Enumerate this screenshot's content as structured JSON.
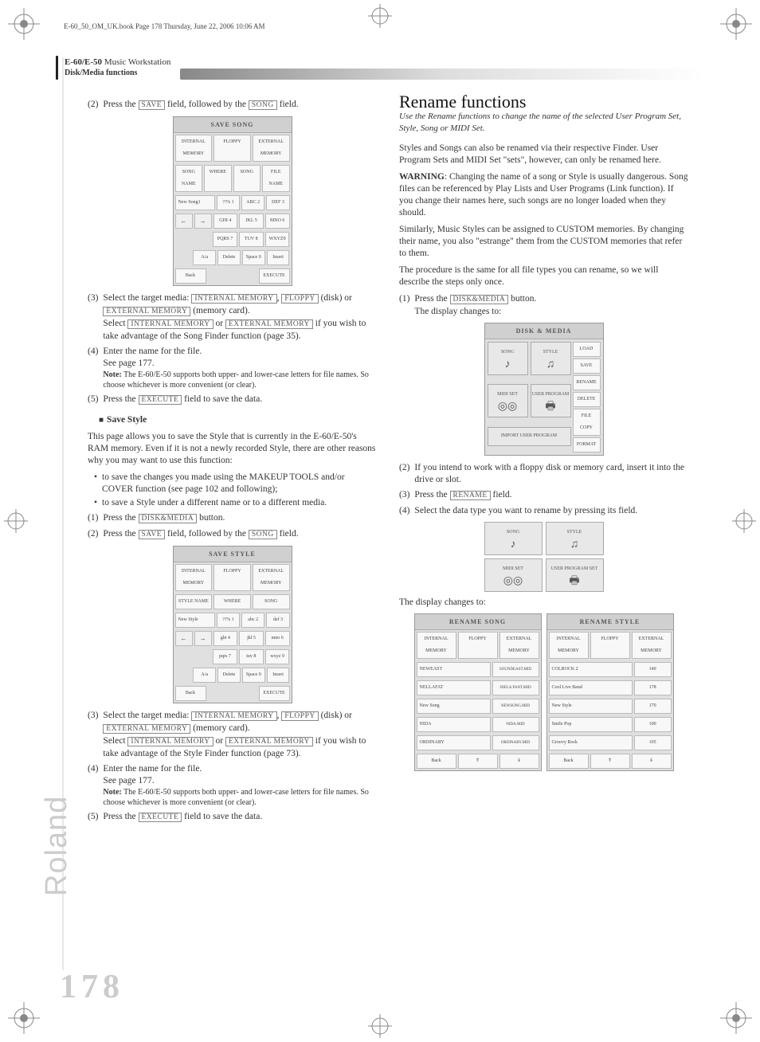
{
  "book_line": "E-60_50_OM_UK.book  Page 178  Thursday, June 22, 2006  10:06 AM",
  "header": {
    "title_prefix": "E-60/E-50",
    "title_suffix": " Music Workstation",
    "subtitle": "Disk/Media functions"
  },
  "left_col": {
    "step2": {
      "num": "(2)",
      "text_a": "Press the ",
      "btn1": "SAVE",
      "text_b": " field, followed by the ",
      "btn2": "SONG",
      "text_c": " field."
    },
    "ss_save_song": {
      "title": "SAVE SONG",
      "tabs": [
        "INTERNAL MEMORY",
        "FLOPPY",
        "EXTERNAL MEMORY"
      ],
      "namefield_label": "SONG NAME",
      "options": [
        "WHERE",
        "SONG",
        "FILE NAME"
      ],
      "name_value": "New Song1",
      "keys": [
        "?!% 1",
        "ABC 2",
        "DEF 3",
        "GHI 4",
        "JKL 5",
        "MNO 6",
        "PQRS 7",
        "TUV 8",
        "WXYZ9",
        "A/a",
        "Delete",
        "Space 0",
        "Insert"
      ],
      "back": "Back",
      "execute": "EXECUTE"
    },
    "step3": {
      "num": "(3)",
      "text_a": "Select the target media: ",
      "btn1": "INTERNAL MEMORY",
      "text_b": ", ",
      "btn2": "FLOPPY",
      "text_c": " (disk) or ",
      "btn3": "EXTERNAL MEMORY",
      "text_d": " (memory card).",
      "line2a": "Select ",
      "line2b": " or ",
      "line2c": " if you wish to take advantage of the Song Finder function (page 35)."
    },
    "step4": {
      "num": "(4)",
      "text_a": "Enter the name for the file.",
      "line2": "See page 177.",
      "note_label": "Note:",
      "note": " The E-60/E-50 supports both upper- and lower-case letters for file names. So choose whichever is more convenient (or clear)."
    },
    "step5": {
      "num": "(5)",
      "text_a": "Press the ",
      "btn1": "EXECUTE",
      "text_b": " field to save the data."
    },
    "save_style_h": "Save Style",
    "save_style_p": "This page allows you to save the Style that is currently in the E-60/E-50's RAM memory. Even if it is not a newly recorded Style, there are other reasons why you may want to use this function:",
    "bullet1": "to save the changes you made using the MAKEUP TOOLS and/or COVER function (see page 102 and following);",
    "bullet2": "to save a Style under a different name or to a different media.",
    "b_step1": {
      "num": "(1)",
      "text_a": "Press the ",
      "btn1": "DISK&MEDIA",
      "text_b": " button."
    },
    "b_step2": {
      "num": "(2)",
      "text_a": "Press the ",
      "btn1": "SAVE",
      "text_b": " field, followed by the ",
      "btn2": "SONG",
      "text_c": " field."
    },
    "ss_save_style": {
      "title": "SAVE STYLE",
      "tabs": [
        "INTERNAL MEMORY",
        "FLOPPY",
        "EXTERNAL MEMORY"
      ],
      "namefield_label": "STYLE NAME",
      "options": [
        "WHERE",
        "SONG"
      ],
      "name_value": "New Style",
      "keys": [
        "?!% 1",
        "abc 2",
        "def 3",
        "ghi 4",
        "jkl 5",
        "mno 6",
        "pqrs 7",
        "tuv 8",
        "wxyz 9",
        "A/a",
        "Delete",
        "Space 0",
        "Insert"
      ],
      "back": "Back",
      "execute": "EXECUTE"
    },
    "c_step3": {
      "num": "(3)",
      "text_a": "Select the target media: ",
      "btn1": "INTERNAL MEMORY",
      "text_b": ", ",
      "btn2": "FLOPPY",
      "text_c": " (disk) or ",
      "btn3": "EXTERNAL MEMORY",
      "text_d": " (memory card).",
      "line2a": "Select ",
      "line2b": " or ",
      "line2c": " if you wish to take advantage of the Style Finder function (page 73)."
    },
    "c_step4": {
      "num": "(4)",
      "text_a": "Enter the name for the file.",
      "line2": "See page 177.",
      "note_label": "Note:",
      "note": " The E-60/E-50 supports both upper- and lower-case letters for file names. So choose whichever is more convenient (or clear)."
    },
    "c_step5": {
      "num": "(5)",
      "text_a": "Press the ",
      "btn1": "EXECUTE",
      "text_b": " field to save the data."
    }
  },
  "right_col": {
    "title": "Rename functions",
    "intro": "Use the Rename functions to change the name of the selected User Program Set, Style, Song or MIDI Set.",
    "p1": "Styles and Songs can also be renamed via their respective Finder. User Program Sets and MIDI Set \"sets\", however, can only be renamed here.",
    "warn_label": "WARNING",
    "warn": ": Changing the name of a song or Style is usually dangerous. Song files can be referenced by Play Lists and User Programs (Link function). If you change their names here, such songs are no longer loaded when they should.",
    "p2": "Similarly, Music Styles can be assigned to CUSTOM memories. By changing their name, you also \"estrange\" them from the CUSTOM memories that refer to them.",
    "p3": "The procedure is the same for all file types you can rename, so we will describe the steps only once.",
    "r_step1": {
      "num": "(1)",
      "text_a": "Press the ",
      "btn1": "DISK&MEDIA",
      "text_b": " button.",
      "line2": "The display changes to:"
    },
    "ss_disk_media": {
      "title": "DISK & MEDIA",
      "items": [
        "SONG",
        "STYLE",
        "MIDI SET",
        "USER PROGRAM",
        "IMPORT USER PROGRAM"
      ],
      "side": [
        "LOAD",
        "SAVE",
        "RENAME",
        "DELETE",
        "FILE COPY",
        "FORMAT"
      ]
    },
    "r_step2": {
      "num": "(2)",
      "text": "If you intend to work with a floppy disk or memory card, insert it into the drive or slot."
    },
    "r_step3": {
      "num": "(3)",
      "text_a": "Press the ",
      "btn1": "RENAME",
      "text_b": " field."
    },
    "r_step4": {
      "num": "(4)",
      "text": "Select the data type you want to rename by pressing its field."
    },
    "ss_grid": {
      "items": [
        "SONG",
        "STYLE",
        "MIDI SET",
        "USER PROGRAM SET"
      ]
    },
    "line_dc": "The display changes to:",
    "ss_rename_song": {
      "title": "RENAME SONG",
      "tabs": [
        "INTERNAL MEMORY",
        "FLOPPY",
        "EXTERNAL MEMORY"
      ],
      "rows": [
        {
          "name": "NEWEAST",
          "info": "SOUNDEAST.MID"
        },
        {
          "name": "NELLAFAT",
          "info": "NIELA FANT.MID"
        },
        {
          "name": "New Song",
          "info": "NEWSONG.MID"
        },
        {
          "name": "NIDA",
          "info": "NIDA.MID"
        },
        {
          "name": "ORDINARY",
          "info": "ORDINARY.MID"
        }
      ],
      "back": "Back"
    },
    "ss_rename_style": {
      "title": "RENAME STYLE",
      "tabs": [
        "INTERNAL MEMORY",
        "FLOPPY",
        "EXTERNAL MEMORY"
      ],
      "rows": [
        {
          "name": "COLROCK 2",
          "info": "140"
        },
        {
          "name": "Cool Live Band",
          "info": "178"
        },
        {
          "name": "New Style",
          "info": "170"
        },
        {
          "name": "Smile Pop",
          "info": "100"
        },
        {
          "name": "Groovy Rock",
          "info": "105"
        }
      ],
      "back": "Back"
    }
  },
  "page_number": "178",
  "brand": "Roland"
}
